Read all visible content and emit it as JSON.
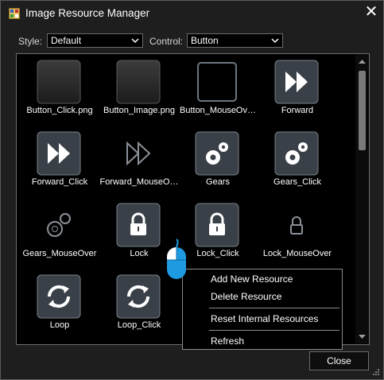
{
  "window": {
    "title": "Image Resource Manager"
  },
  "toolbar": {
    "style_label": "Style:",
    "style_value": "Default",
    "control_label": "Control:",
    "control_value": "Button"
  },
  "resources": [
    {
      "label": "Button_Click.png",
      "icon": "blank-button-icon"
    },
    {
      "label": "Button_Image.png",
      "icon": "blank-button-icon"
    },
    {
      "label": "Button_MouseOv…",
      "icon": "outline-button-icon"
    },
    {
      "label": "Forward",
      "icon": "forward-icon"
    },
    {
      "label": "Forward_Click",
      "icon": "forward-icon"
    },
    {
      "label": "Forward_MouseO…",
      "icon": "forward-outline-icon"
    },
    {
      "label": "Gears",
      "icon": "gears-icon"
    },
    {
      "label": "Gears_Click",
      "icon": "gears-icon"
    },
    {
      "label": "Gears_MouseOver",
      "icon": "gears-outline-icon"
    },
    {
      "label": "Lock",
      "icon": "lock-icon"
    },
    {
      "label": "Lock_Click",
      "icon": "lock-icon"
    },
    {
      "label": "Lock_MouseOver",
      "icon": "lock-outline-icon"
    },
    {
      "label": "Loop",
      "icon": "loop-icon"
    },
    {
      "label": "Loop_Click",
      "icon": "loop-icon"
    }
  ],
  "context_menu": {
    "items": [
      "Add New Resource",
      "Delete Resource",
      "Reset Internal Resources",
      "Refresh"
    ]
  },
  "footer": {
    "close_label": "Close"
  },
  "colors": {
    "background": "#1e1e1e",
    "list_background": "#000000",
    "accent": "#1e9be0"
  }
}
